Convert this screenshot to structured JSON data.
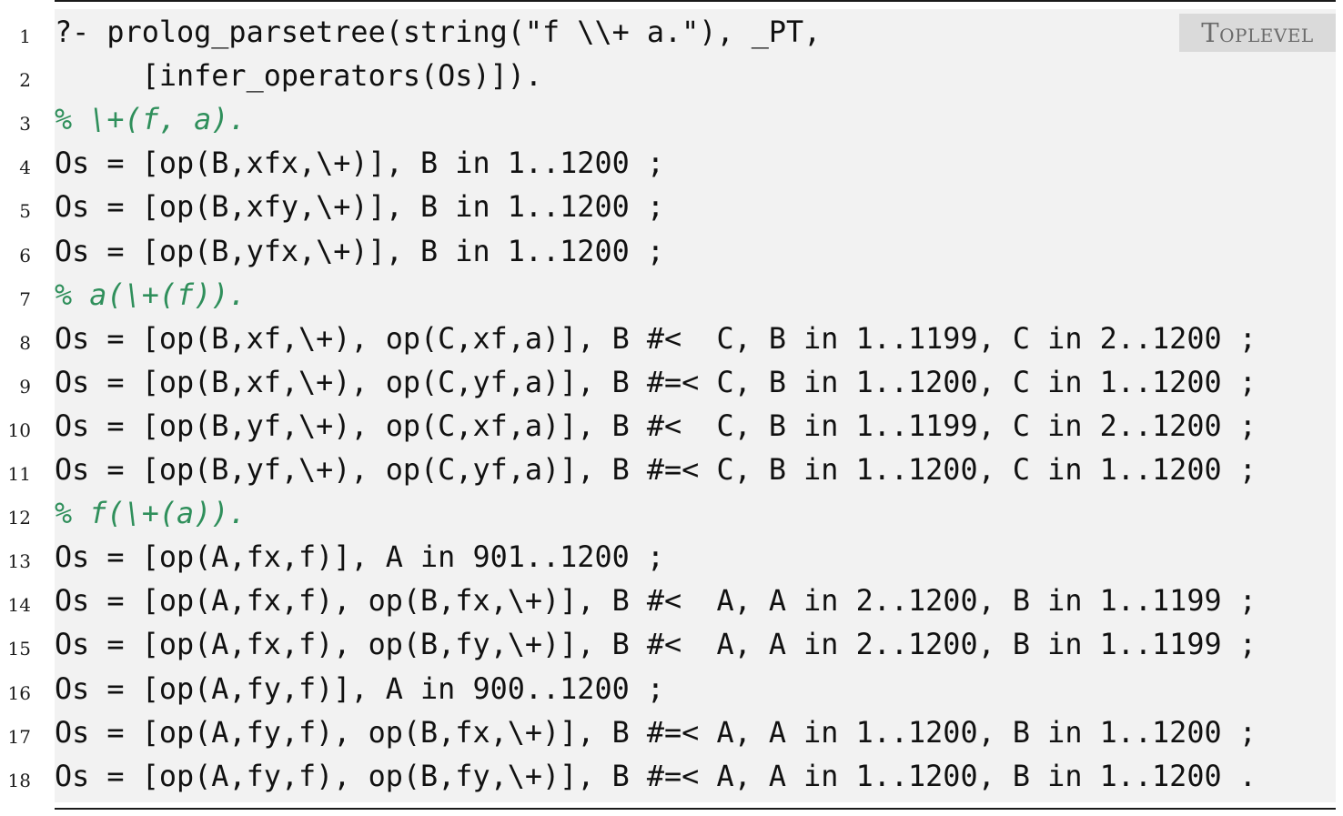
{
  "tag_label": "Toplevel",
  "lines": [
    {
      "n": "1",
      "text": "?- prolog_parsetree(string(\"f \\\\+ a.\"), _PT,",
      "comment": false
    },
    {
      "n": "2",
      "text": "     [infer_operators(Os)]).",
      "comment": false
    },
    {
      "n": "3",
      "text": "% \\+(f, a).",
      "comment": true
    },
    {
      "n": "4",
      "text": "Os = [op(B,xfx,\\+)], B in 1..1200 ;",
      "comment": false
    },
    {
      "n": "5",
      "text": "Os = [op(B,xfy,\\+)], B in 1..1200 ;",
      "comment": false
    },
    {
      "n": "6",
      "text": "Os = [op(B,yfx,\\+)], B in 1..1200 ;",
      "comment": false
    },
    {
      "n": "7",
      "text": "% a(\\+(f)).",
      "comment": true
    },
    {
      "n": "8",
      "text": "Os = [op(B,xf,\\+), op(C,xf,a)], B #<  C, B in 1..1199, C in 2..1200 ;",
      "comment": false
    },
    {
      "n": "9",
      "text": "Os = [op(B,xf,\\+), op(C,yf,a)], B #=< C, B in 1..1200, C in 1..1200 ;",
      "comment": false
    },
    {
      "n": "10",
      "text": "Os = [op(B,yf,\\+), op(C,xf,a)], B #<  C, B in 1..1199, C in 2..1200 ;",
      "comment": false
    },
    {
      "n": "11",
      "text": "Os = [op(B,yf,\\+), op(C,yf,a)], B #=< C, B in 1..1200, C in 1..1200 ;",
      "comment": false
    },
    {
      "n": "12",
      "text": "% f(\\+(a)).",
      "comment": true
    },
    {
      "n": "13",
      "text": "Os = [op(A,fx,f)], A in 901..1200 ;",
      "comment": false
    },
    {
      "n": "14",
      "text": "Os = [op(A,fx,f), op(B,fx,\\+)], B #<  A, A in 2..1200, B in 1..1199 ;",
      "comment": false
    },
    {
      "n": "15",
      "text": "Os = [op(A,fx,f), op(B,fy,\\+)], B #<  A, A in 2..1200, B in 1..1199 ;",
      "comment": false
    },
    {
      "n": "16",
      "text": "Os = [op(A,fy,f)], A in 900..1200 ;",
      "comment": false
    },
    {
      "n": "17",
      "text": "Os = [op(A,fy,f), op(B,fx,\\+)], B #=< A, A in 1..1200, B in 1..1200 ;",
      "comment": false
    },
    {
      "n": "18",
      "text": "Os = [op(A,fy,f), op(B,fy,\\+)], B #=< A, A in 1..1200, B in 1..1200 .",
      "comment": false
    }
  ]
}
